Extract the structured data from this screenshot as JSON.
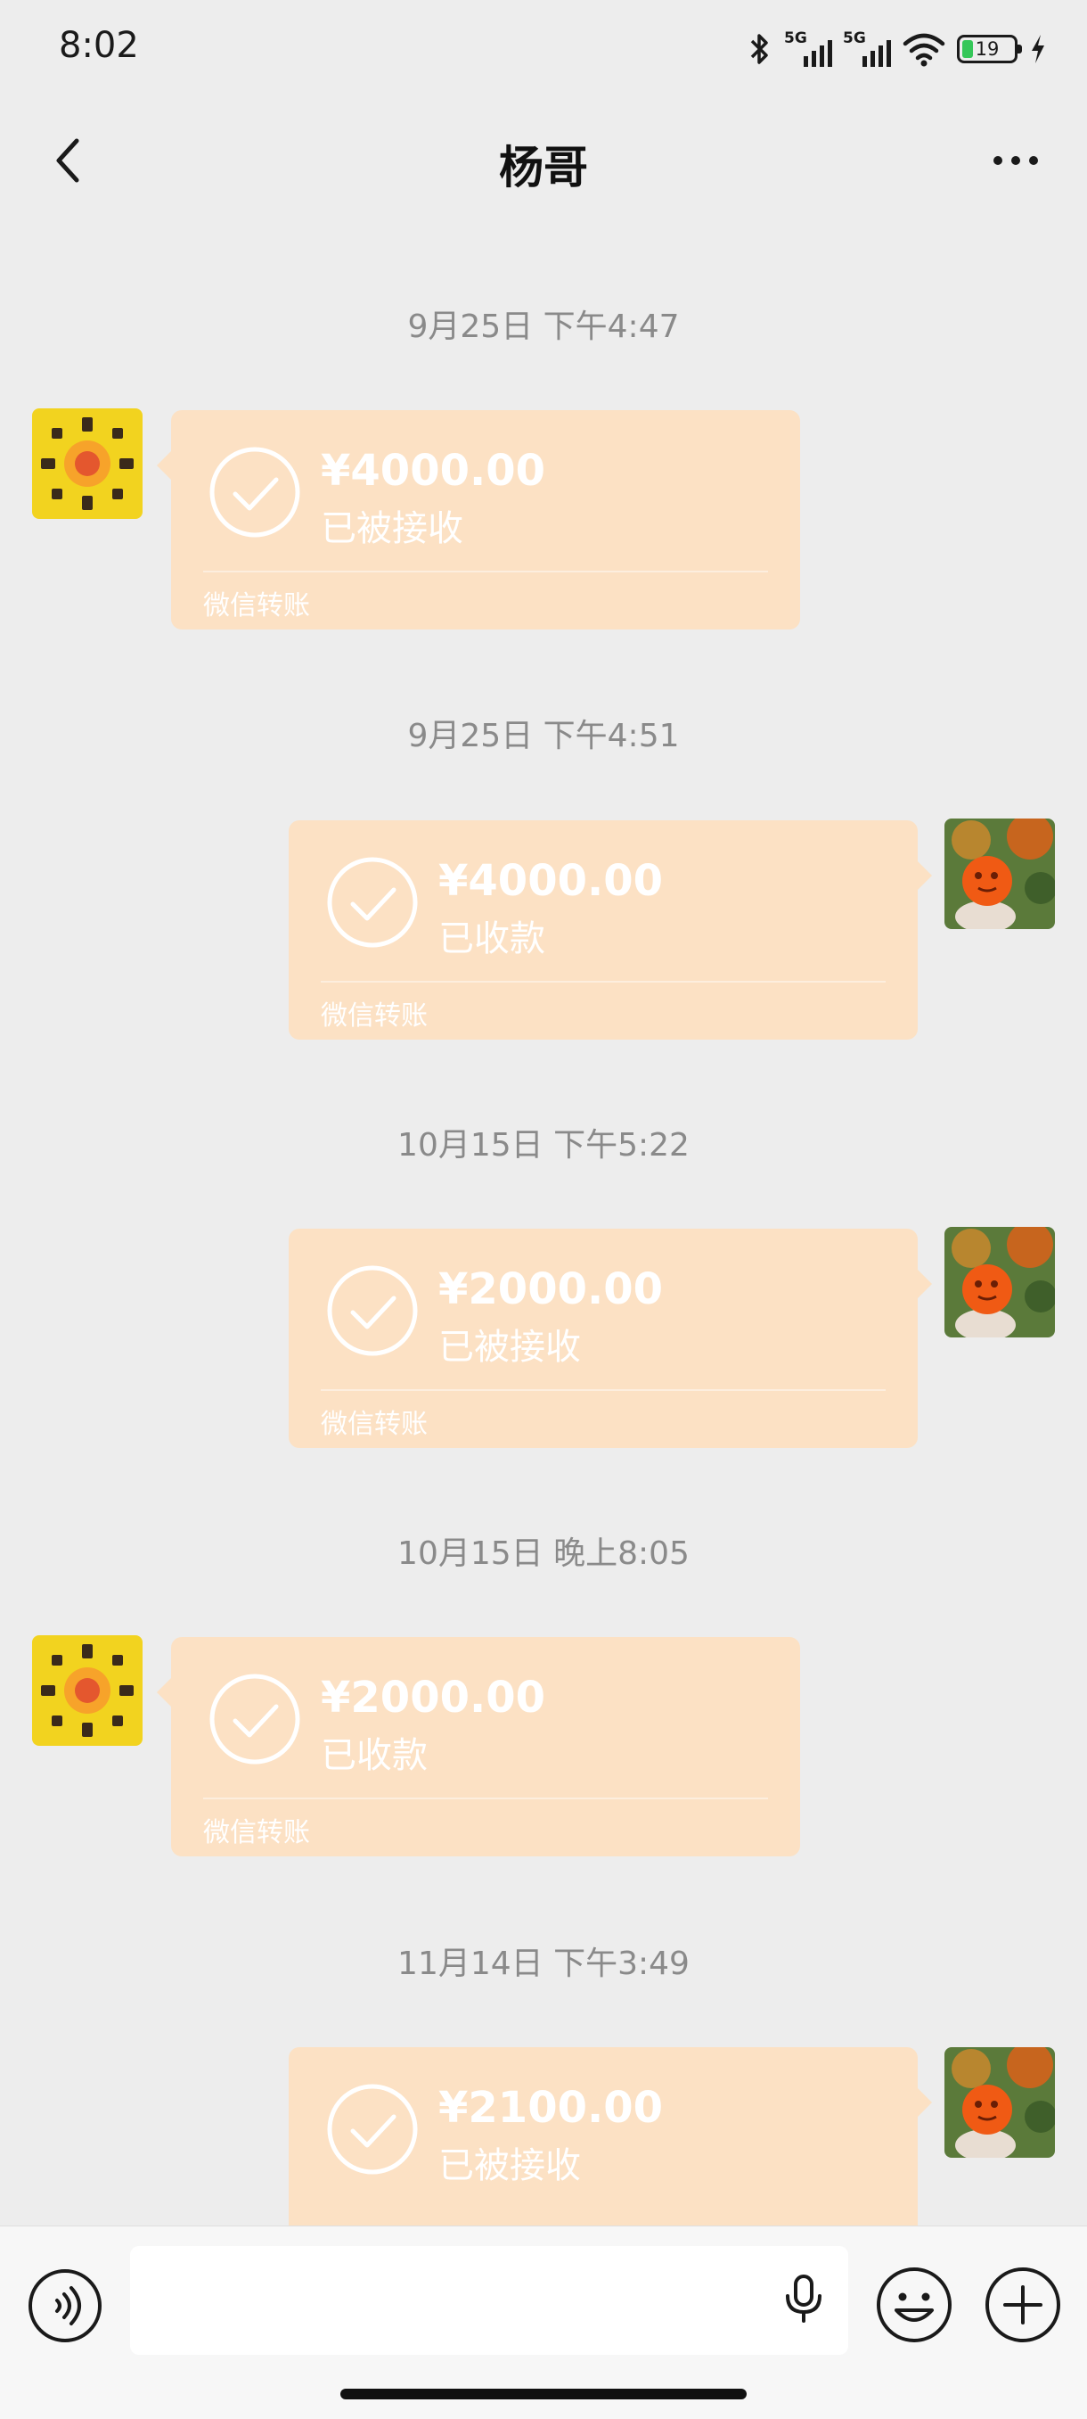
{
  "status_bar": {
    "time": "8:02",
    "network_1": "5G",
    "network_2": "5G",
    "battery": "19"
  },
  "header": {
    "title": "杨哥",
    "back_icon": "chevron-left-icon",
    "more_icon": "more-dots-icon"
  },
  "messages": [
    {
      "time": "9月25日 下午4:47",
      "side": "left",
      "amount": "¥4000.00",
      "status": "已被接收",
      "footer": "微信转账"
    },
    {
      "time": "9月25日 下午4:51",
      "side": "right",
      "amount": "¥4000.00",
      "status": "已收款",
      "footer": "微信转账"
    },
    {
      "time": "10月15日 下午5:22",
      "side": "right",
      "amount": "¥2000.00",
      "status": "已被接收",
      "footer": "微信转账"
    },
    {
      "time": "10月15日 晚上8:05",
      "side": "left",
      "amount": "¥2000.00",
      "status": "已收款",
      "footer": "微信转账"
    },
    {
      "time": "11月14日 下午3:49",
      "side": "right",
      "amount": "¥2100.00",
      "status": "已被接收",
      "footer": ""
    }
  ],
  "input_bar": {
    "voice_icon": "voice-mode-icon",
    "mic_icon": "microphone-icon",
    "emoji_icon": "emoji-icon",
    "plus_icon": "plus-icon",
    "value": ""
  },
  "colors": {
    "background": "#ededed",
    "transfer_bubble": "#fce1c4",
    "timestamp_text": "#8a8a8a"
  }
}
